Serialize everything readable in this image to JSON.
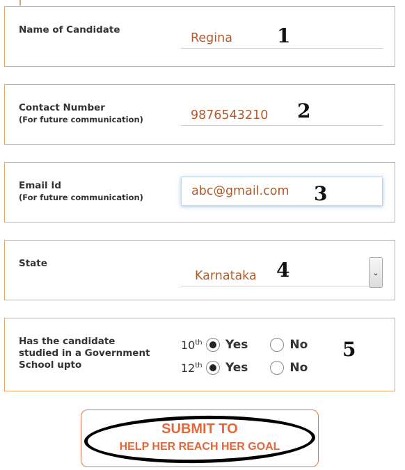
{
  "form": {
    "name": {
      "label": "Name of Candidate",
      "value": "Regina",
      "marker": "1"
    },
    "contact": {
      "label": "Contact Number",
      "sublabel": "(For future communication)",
      "value": "9876543210",
      "marker": "2"
    },
    "email": {
      "label": "Email Id",
      "sublabel": "(For future communication)",
      "value": "abc@gmail.com",
      "marker": "3"
    },
    "state": {
      "label": "State",
      "value": "Karnataka",
      "marker": "4"
    },
    "school": {
      "label": "Has the candidate studied in a Government School upto",
      "marker": "5",
      "rows": [
        {
          "grade": "10",
          "suffix": "th",
          "yes": "Yes",
          "no": "No",
          "selected": "Yes"
        },
        {
          "grade": "12",
          "suffix": "th",
          "yes": "Yes",
          "no": "No",
          "selected": "Yes"
        }
      ]
    }
  },
  "submit": {
    "line1": "SUBMIT TO",
    "line2": "HELP HER REACH HER GOAL"
  },
  "colors": {
    "border": "#e8a468",
    "value_text": "#b25a2c",
    "submit_text": "#e4673a"
  }
}
